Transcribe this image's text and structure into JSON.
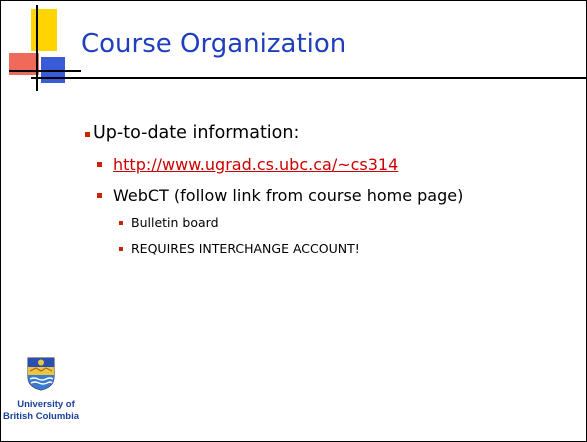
{
  "slide": {
    "title": "Course Organization",
    "main_bullet": "Up-to-date information:",
    "items": [
      {
        "text": "http://www.ugrad.cs.ubc.ca/~cs314",
        "is_link": true
      },
      {
        "text": "WebCT (follow link from course home page)",
        "is_link": false
      }
    ],
    "subitems": [
      "Bulletin board",
      "REQUIRES INTERCHANGE ACCOUNT!"
    ]
  },
  "logo": {
    "line1": "University of",
    "line2": "British Columbia"
  },
  "colors": {
    "title": "#1f3fbf",
    "bullet": "#cc2200",
    "link": "#cc0000",
    "logo_text": "#1a3f9a"
  }
}
